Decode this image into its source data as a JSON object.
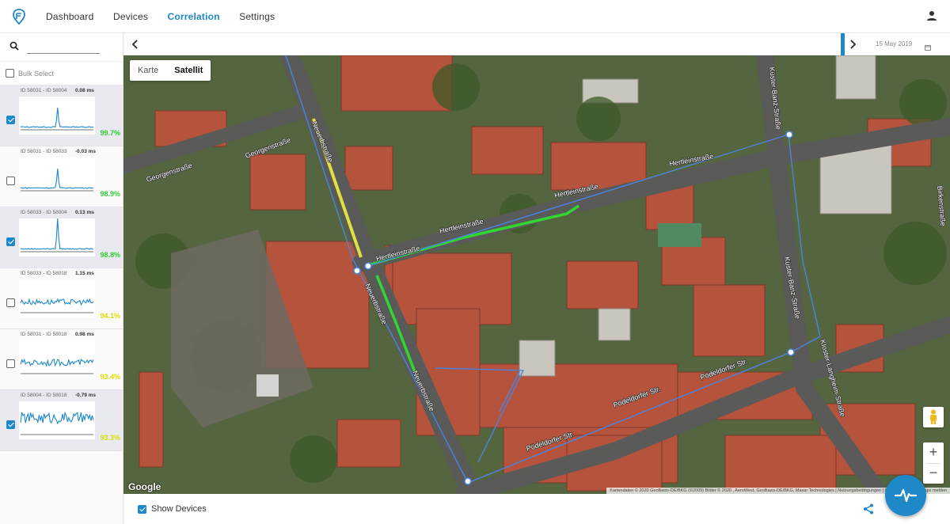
{
  "nav": {
    "items": [
      {
        "label": "Dashboard"
      },
      {
        "label": "Devices"
      },
      {
        "label": "Correlation"
      },
      {
        "label": "Settings"
      }
    ],
    "active": "Correlation"
  },
  "sidebar": {
    "search": {
      "value": "",
      "placeholder": ""
    },
    "bulk_select_label": "Bulk Select",
    "items": [
      {
        "ids": "ID 58031 - ID 58004",
        "ms": "0.08 ms",
        "pct": "99.7%",
        "checked": true,
        "selected": true,
        "pct_color": "#33cc33",
        "shape": "spike"
      },
      {
        "ids": "ID 58031 - ID 58033",
        "ms": "-0.03 ms",
        "pct": "98.9%",
        "checked": false,
        "selected": false,
        "pct_color": "#33cc33",
        "shape": "spike"
      },
      {
        "ids": "ID 58033 - ID 58004",
        "ms": "0.13 ms",
        "pct": "98.8%",
        "checked": true,
        "selected": true,
        "pct_color": "#33cc33",
        "shape": "spike-tall"
      },
      {
        "ids": "ID 58033 - ID 58018",
        "ms": "1.15 ms",
        "pct": "94.1%",
        "checked": false,
        "selected": false,
        "pct_color": "#dddd00",
        "shape": "noise"
      },
      {
        "ids": "ID 58031 - ID 58018",
        "ms": "0.98 ms",
        "pct": "93.4%",
        "checked": false,
        "selected": false,
        "pct_color": "#dddd00",
        "shape": "noise-dense"
      },
      {
        "ids": "ID 58004 - ID 58018",
        "ms": "-0.79 ms",
        "pct": "93.3%",
        "checked": true,
        "selected": true,
        "pct_color": "#dddd00",
        "shape": "noise-big"
      }
    ]
  },
  "timeline": {
    "date": "15 May 2019"
  },
  "map": {
    "type_buttons": [
      {
        "label": "Karte"
      },
      {
        "label": "Satellit"
      }
    ],
    "active_type": "Satellit",
    "google_label": "Google",
    "attribution": "Kartendaten © 2020 GeoBasis-DE/BKG (©2009) Bilder © 2020 , AeroWest, GeoBasis-DE/BKG, Maxar Technologies | Nutzungsbedingungen | Fehler bei Google Maps melden",
    "streets": [
      {
        "label": "Georgenstraße"
      },
      {
        "label": "Georgenstraße"
      },
      {
        "label": "Neuerbstraße"
      },
      {
        "label": "Neuerbstraße"
      },
      {
        "label": "Neuerbstraße"
      },
      {
        "label": "Hertleinstraße"
      },
      {
        "label": "Hertleinstraße"
      },
      {
        "label": "Hertleinstraße"
      },
      {
        "label": "Hertleinstraße"
      },
      {
        "label": "Küster-Banz-Straße"
      },
      {
        "label": "Küster-Banz-Straße"
      },
      {
        "label": "Pödeldorfer Str."
      },
      {
        "label": "Pödeldorfer Str."
      },
      {
        "label": "Pödeldorfer Str."
      },
      {
        "label": "Birkenstraße"
      },
      {
        "label": "Kloster-Langheim-Straße"
      }
    ],
    "zoom_in": "+",
    "zoom_out": "−"
  },
  "footer": {
    "show_devices_label": "Show Devices",
    "show_devices_checked": true
  },
  "colors": {
    "accent": "#1e88c8",
    "good": "#33cc33",
    "warn": "#dddd00"
  },
  "icons": [
    "logo-icon",
    "user-icon",
    "search-icon",
    "chevron-left-icon",
    "chevron-right-icon",
    "calendar-icon",
    "pegman-icon",
    "share-icon",
    "activity-icon"
  ]
}
